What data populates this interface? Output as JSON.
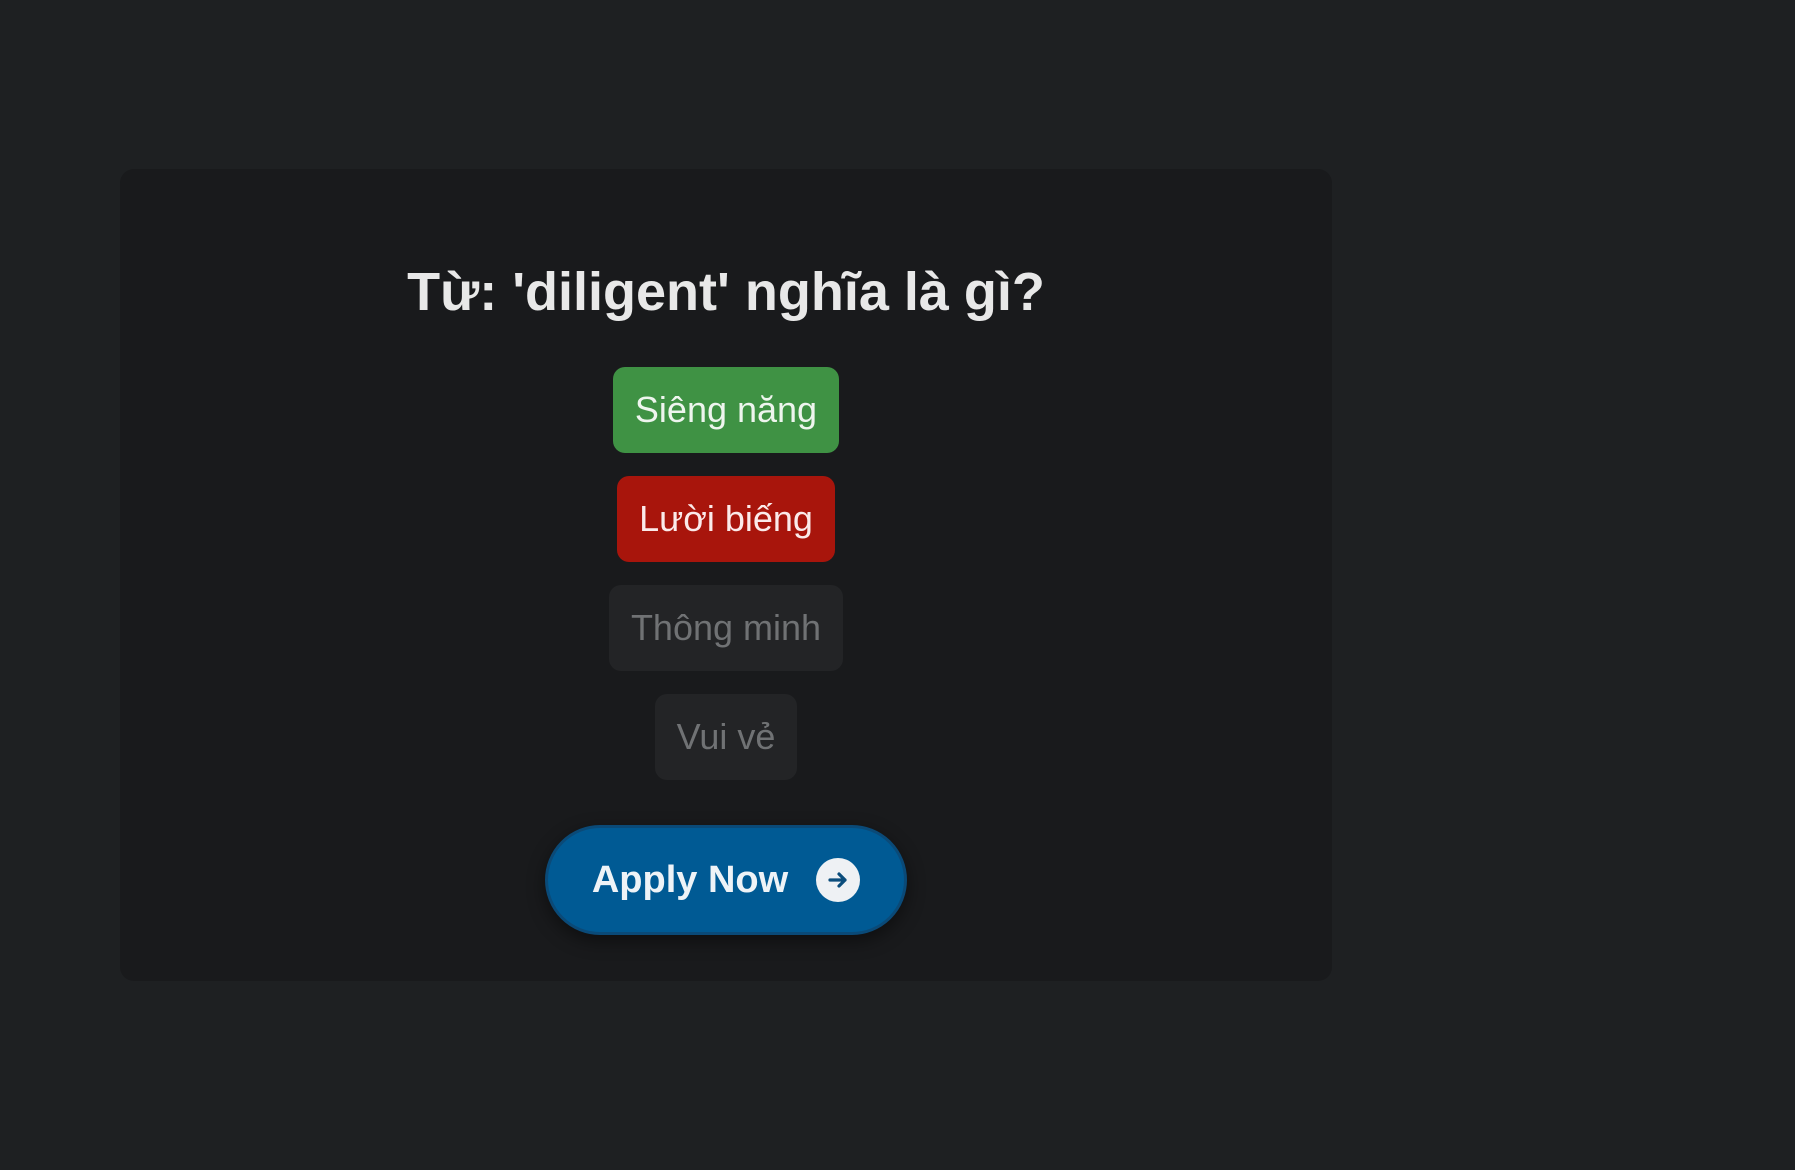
{
  "quiz": {
    "question": "Từ: 'diligent' nghĩa là gì?",
    "options": [
      {
        "label": "Siêng năng",
        "state": "correct"
      },
      {
        "label": "Lười biếng",
        "state": "wrong"
      },
      {
        "label": "Thông minh",
        "state": "disabled"
      },
      {
        "label": "Vui vẻ",
        "state": "disabled"
      }
    ]
  },
  "apply_button": {
    "label": "Apply Now",
    "icon": "arrow-right-icon"
  },
  "colors": {
    "page_background": "#1e2022",
    "card_background": "#191a1c",
    "correct": "#3f9244",
    "wrong": "#a8150c",
    "disabled": "#232426",
    "primary": "#005a94"
  }
}
